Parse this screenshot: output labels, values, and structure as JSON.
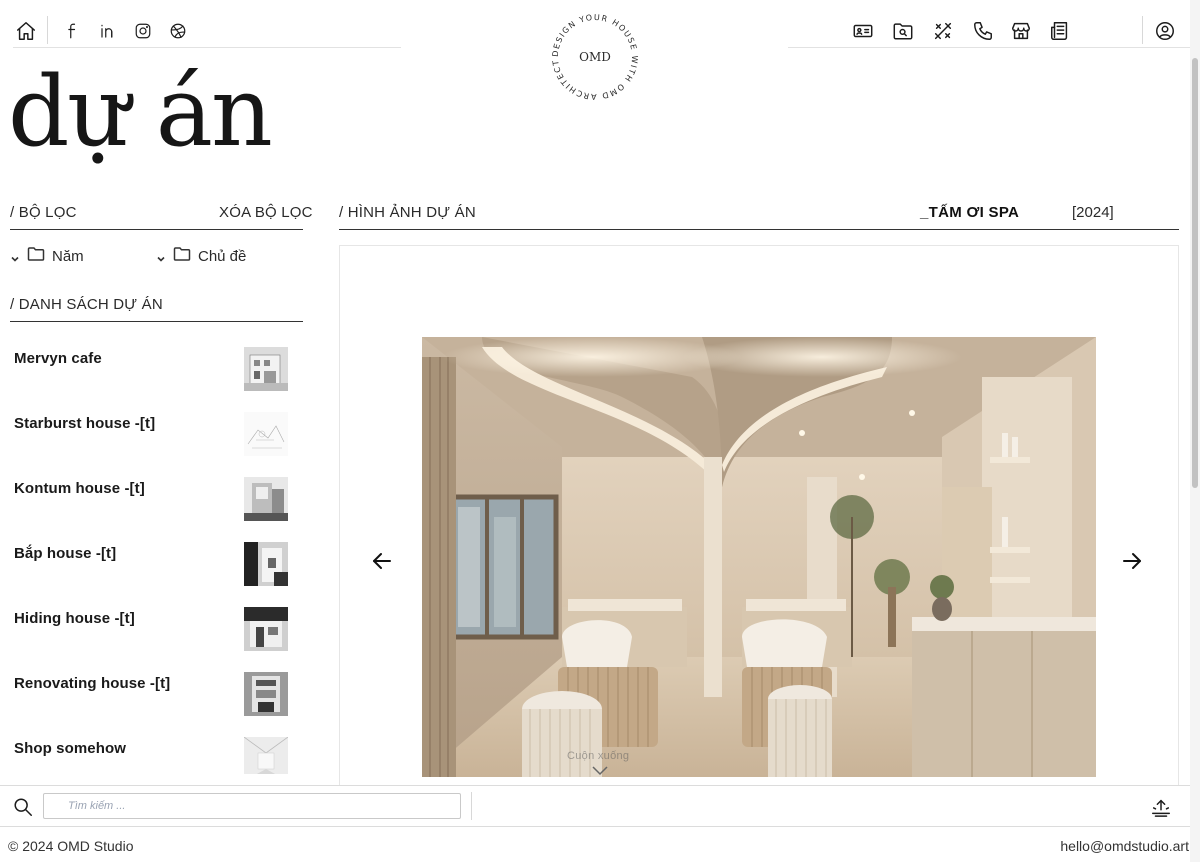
{
  "brand": {
    "monogram": "OMD",
    "ring_text": "DESIGN YOUR HOUSE WITH OMD ARCHITECT",
    "text_color": "#2b2b2b"
  },
  "header": {
    "left_icons": [
      "home-icon",
      "facebook-icon",
      "linkedin-icon",
      "instagram-icon",
      "dribbble-icon"
    ],
    "right_icons": [
      "contact-card-icon",
      "folder-search-icon",
      "design-tools-icon",
      "phone-icon",
      "store-icon",
      "news-icon",
      "user-icon"
    ]
  },
  "page": {
    "title": "dự án"
  },
  "filters": {
    "heading": "/ BỘ LỌC",
    "clear_label": "XÓA BỘ LỌC",
    "year_label": "Năm",
    "topic_label": "Chủ đề"
  },
  "project_list": {
    "heading": "/ DANH SÁCH DỰ ÁN",
    "items": [
      {
        "name": "Mervyn cafe"
      },
      {
        "name": "Starburst house -[t]"
      },
      {
        "name": "Kontum house -[t]"
      },
      {
        "name": "Bắp house -[t]"
      },
      {
        "name": "Hiding house -[t]"
      },
      {
        "name": "Renovating house -[t]"
      },
      {
        "name": "Shop somehow"
      }
    ]
  },
  "gallery": {
    "heading": "/ HÌNH ẢNH DỰ ÁN",
    "project_title": "_TẤM ƠI SPA",
    "project_year": "[2024]",
    "scroll_hint": "Cuộn xuống",
    "prev_icon": "arrow-left-icon",
    "next_icon": "arrow-right-icon"
  },
  "search": {
    "placeholder": "Tìm kiếm ..."
  },
  "footer": {
    "copyright": "© 2024 OMD Studio",
    "email": "hello@omdstudio.art"
  },
  "colors": {
    "text": "#1c1c1c",
    "rule": "#333333",
    "spa_beige": "#d9c8b2",
    "spa_wall": "#e6d9c7"
  }
}
